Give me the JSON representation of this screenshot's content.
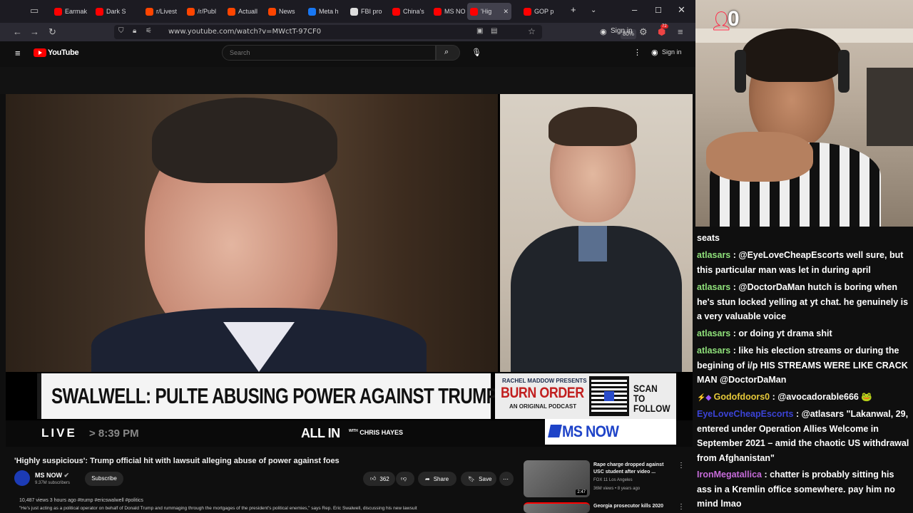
{
  "browser": {
    "tabs": [
      {
        "label": "Earmak",
        "color": "#ff0000"
      },
      {
        "label": "Dark S",
        "color": "#ff0000"
      },
      {
        "label": "r/Livest",
        "color": "#ff4500"
      },
      {
        "label": "/r/Publ",
        "color": "#ff4500"
      },
      {
        "label": "Actuall",
        "color": "#ff4500"
      },
      {
        "label": "News",
        "color": "#ff4500"
      },
      {
        "label": "Meta h",
        "color": "#1877f2"
      },
      {
        "label": "FBI pro",
        "color": "#dddddd"
      },
      {
        "label": "China's",
        "color": "#ff0000"
      },
      {
        "label": "MS NO",
        "color": "#ff0000"
      },
      {
        "label": "'Hig",
        "color": "#ff0000"
      },
      {
        "label": "GOP p",
        "color": "#ff0000"
      }
    ],
    "url": "www.youtube.com/watch?v=MWctT-97CF0",
    "zoom": "80%",
    "sign_in": "Sign in",
    "badge": "72"
  },
  "youtube": {
    "logo": "YouTube",
    "search_placeholder": "Search",
    "sign_in": "Sign in"
  },
  "video": {
    "chyron": "SWALWELL: PULTE ABUSING POWER AGAINST TRUMP CRITICS",
    "promo_host": "RACHEL MADDOW PRESENTS",
    "promo_title": "BURN ORDER",
    "promo_sub": "AN ORIGINAL PODCAST",
    "promo_cta_1": "SCAN TO",
    "promo_cta_2": "FOLLOW",
    "live": "LIVE",
    "live_time": "> 8:39 PM",
    "show_title": "ALL IN",
    "show_sub_1": "WITH",
    "show_sub_2": "CHRIS HAYES",
    "network": "MS NOW"
  },
  "details": {
    "title": "'Highly suspicious': Trump official hit with lawsuit alleging abuse of power against foes",
    "channel": "MS NOW",
    "subscribers": "9.37M subscribers",
    "subscribe": "Subscribe",
    "likes": "362",
    "share": "Share",
    "save": "Save",
    "meta": "10,487 views  3 hours ago  #trump #ericswalwell #politics",
    "description": "\"He's just acting as a political operator on behalf of Donald Trump and rummaging through the mortgages of the president's political enemies,\" says Rep. Eric Swalwell, discussing his new lawsuit"
  },
  "recommendations": [
    {
      "title": "Rape charge dropped against USC student after video ...",
      "channel": "FOX 11 Los Angeles",
      "stats": "36M views • 8 years ago",
      "duration": "2:47"
    },
    {
      "title": "Georgia prosecutor kills 2020",
      "channel": "",
      "stats": "",
      "duration": ""
    }
  ],
  "stream": {
    "viewer_count": "0"
  },
  "chat": [
    {
      "user": "",
      "text": "seats",
      "color": "#ffffff"
    },
    {
      "user": "atlasars",
      "text": " : @EyeLoveCheapEscorts well sure, but this particular man was let in during april",
      "color": "#8fe07a"
    },
    {
      "user": "atlasars",
      "text": " : @DoctorDaMan hutch is boring when he's stun locked yelling at yt chat. he genuinely is a very valuable voice",
      "color": "#8fe07a"
    },
    {
      "user": "atlasars",
      "text": " : or doing yt drama shit",
      "color": "#8fe07a"
    },
    {
      "user": "atlasars",
      "text": " : like his election streams or during the begining of i/p HIS STREAMS WERE LIKE CRACK MAN @DoctorDaMan",
      "color": "#8fe07a"
    },
    {
      "user": "Godofdoors0",
      "text": " : @avocadorable666 🐸",
      "color": "#e6c93a"
    },
    {
      "user": "EyeLoveCheapEscorts",
      "text": " : @atlasars \"Lakanwal, 29, entered under Operation Allies Welcome in September 2021 – amid the chaotic US withdrawal from Afghanistan\"",
      "color": "#3b43d6"
    },
    {
      "user": "IronMegatallica",
      "text": " : chatter is probably sitting his ass in a Kremlin office somewhere. pay him no mind lmao",
      "color": "#c66bd9"
    }
  ]
}
